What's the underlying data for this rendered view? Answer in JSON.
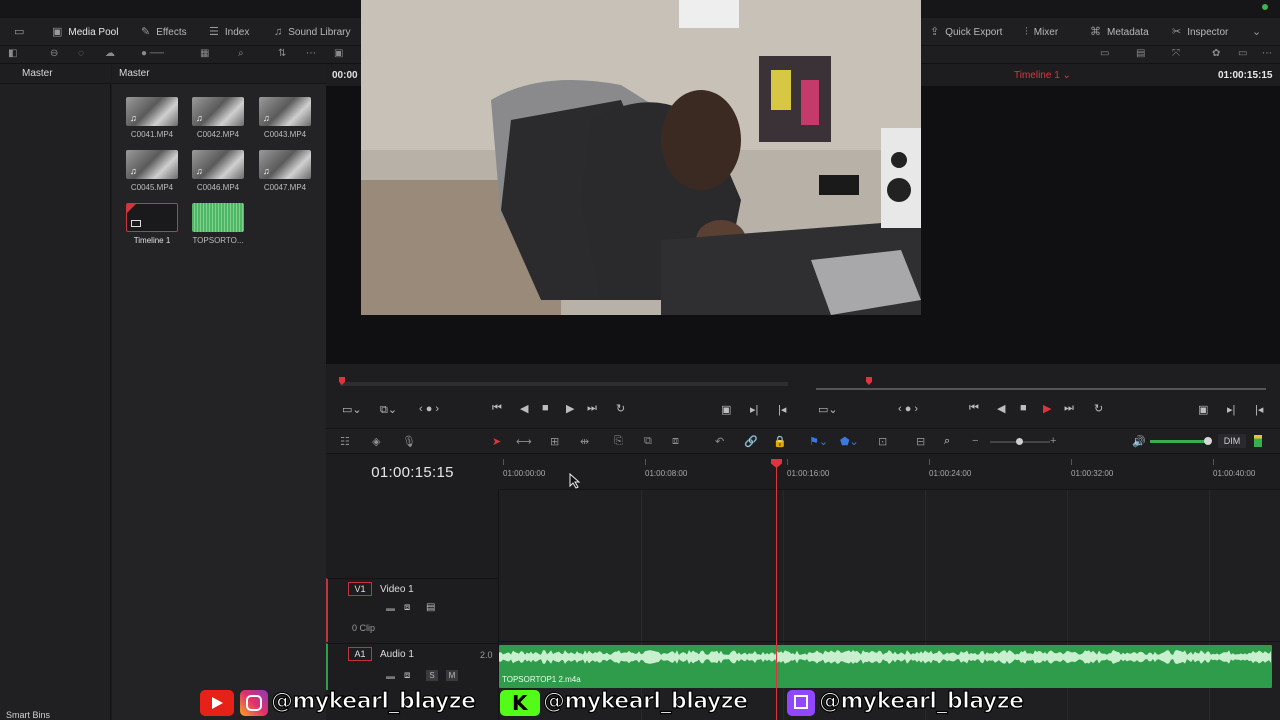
{
  "toolbar": {
    "media_pool": "Media Pool",
    "effects": "Effects",
    "index": "Index",
    "sound_library": "Sound Library",
    "quick_export": "Quick Export",
    "mixer": "Mixer",
    "metadata": "Metadata",
    "inspector": "Inspector"
  },
  "left_panel": {
    "header": "Master",
    "smart_bins": "Smart Bins"
  },
  "media_pool": {
    "header": "Master",
    "clips": [
      {
        "label": "C0041.MP4"
      },
      {
        "label": "C0042.MP4"
      },
      {
        "label": "C0043.MP4"
      },
      {
        "label": "C0045.MP4"
      },
      {
        "label": "C0046.MP4"
      },
      {
        "label": "C0047.MP4"
      },
      {
        "label": "Timeline 1"
      },
      {
        "label": "TOPSORTO..."
      }
    ]
  },
  "viewer": {
    "source_timecode": "00:00",
    "timeline_name": "Timeline 1",
    "timeline_timecode": "01:00:15:15"
  },
  "timeline": {
    "timecode": "01:00:15:15",
    "ruler": [
      "01:00:00:00",
      "01:00:08:00",
      "01:00:16:00",
      "01:00:24:00",
      "01:00:32:00",
      "01:00:40:00"
    ],
    "video_track": {
      "badge": "V1",
      "name": "Video 1",
      "clips": "0 Clip"
    },
    "audio_track": {
      "badge": "A1",
      "name": "Audio 1",
      "channels": "2.0",
      "clip_name": "TOPSORTOP1 2.m4a"
    },
    "dim_label": "DIM"
  },
  "overlay": {
    "handle_1": "@mykearl_blayze",
    "handle_2": "@mykearl_blayze",
    "handle_3": "@mykearl_blayze"
  },
  "colors": {
    "accent_red": "#e0343c",
    "audio_green": "#2f9c4c"
  }
}
